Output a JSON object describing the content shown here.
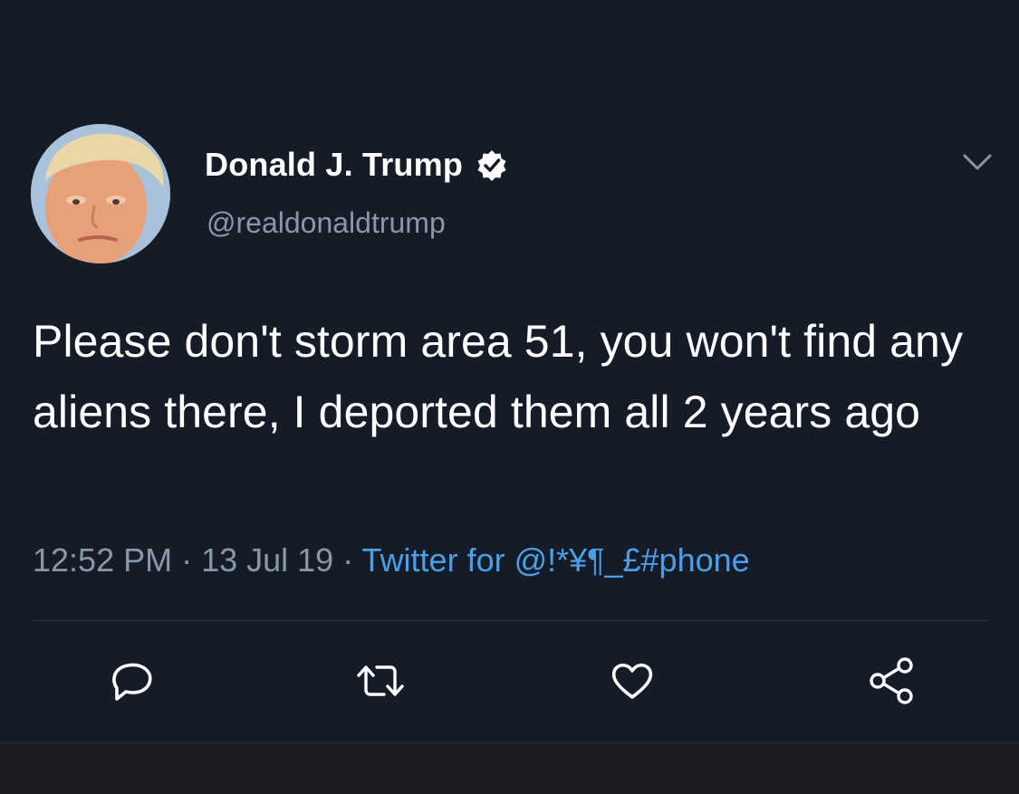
{
  "tweet": {
    "author": {
      "display_name": "Donald J. Trump",
      "handle": "@realdonaldtrump",
      "verified": true
    },
    "text": "Please don't storm area 51, you won't find any aliens there, I deported them all 2 years ago",
    "time": "12:52 PM",
    "separator": " · ",
    "date": "13 Jul 19",
    "source": "Twitter for @!*¥¶_£#phone"
  },
  "icons": {
    "verified": "verified-badge-icon",
    "menu": "chevron-down-icon",
    "reply": "reply-bubble-icon",
    "retweet": "retweet-icon",
    "like": "heart-icon",
    "share": "share-icon"
  },
  "colors": {
    "background": "#151c27",
    "text_primary": "#ffffff",
    "text_secondary": "#8899a6",
    "link": "#4a9fe8",
    "divider": "#2c3744"
  }
}
